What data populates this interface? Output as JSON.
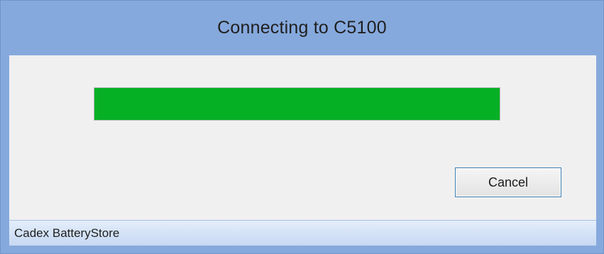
{
  "window": {
    "title": "Connecting to C5100"
  },
  "progress": {
    "value": 1.0,
    "color": "#06b025"
  },
  "buttons": {
    "cancel_label": "Cancel"
  },
  "statusbar": {
    "text": "Cadex BatteryStore"
  }
}
